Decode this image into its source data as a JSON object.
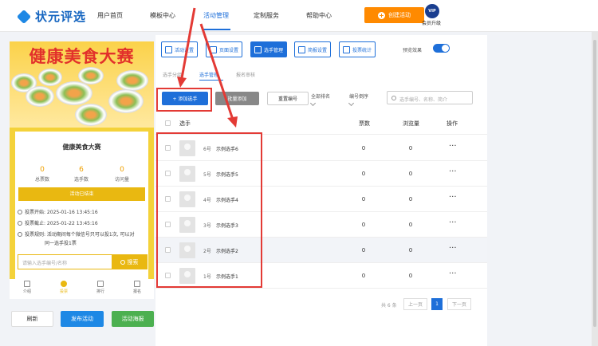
{
  "brand": {
    "name": "状元评选"
  },
  "nav": {
    "items": [
      "用户首页",
      "模板中心",
      "活动管理",
      "定制服务",
      "帮助中心"
    ],
    "create_label": "创建活动",
    "vip_text": "VIP",
    "vip_label": "会员升级"
  },
  "preview": {
    "banner_title": "健康美食大赛",
    "event_title": "健康美食大赛",
    "stats": [
      {
        "value": "0",
        "label": "总票数"
      },
      {
        "value": "6",
        "label": "选手数"
      },
      {
        "value": "0",
        "label": "访问量"
      }
    ],
    "status": "活动已结束",
    "vote_start": "投票开始: 2025-01-16 13:45:16",
    "vote_end": "投票截止: 2025-01-22 13:45:16",
    "rule_line1": "投票规则: 活动期间每个微信号只可以投1次, 可以对",
    "rule_line2": "同一选手投1票",
    "search_placeholder": "请输入选手编号/名称",
    "search_button": "搜索",
    "tabs": [
      "介绍",
      "投票",
      "排行",
      "报名"
    ]
  },
  "actions": {
    "refresh": "刷新",
    "publish": "发布活动",
    "poster": "活动海报"
  },
  "toolbar": {
    "buttons": [
      "活动设置",
      "页面设置",
      "选手管理",
      "简报设置",
      "投票统计"
    ],
    "preview_label": "预览效果"
  },
  "subtabs": [
    "选手分组",
    "选手管理",
    "报名审核"
  ],
  "controls": {
    "add": "+ 添加选手",
    "batch": "批量添加",
    "reset": "重置编号",
    "sort1": "全部排名",
    "sort2": "编号倒序",
    "search_placeholder": "选手编号、名称、简介"
  },
  "table": {
    "headers": [
      "选手",
      "票数",
      "浏览量",
      "操作"
    ],
    "rows": [
      {
        "num": "6号",
        "name": "示例选手6",
        "votes": "0",
        "views": "0"
      },
      {
        "num": "5号",
        "name": "示例选手5",
        "votes": "0",
        "views": "0"
      },
      {
        "num": "4号",
        "name": "示例选手4",
        "votes": "0",
        "views": "0"
      },
      {
        "num": "3号",
        "name": "示例选手3",
        "votes": "0",
        "views": "0"
      },
      {
        "num": "2号",
        "name": "示例选手2",
        "votes": "0",
        "views": "0"
      },
      {
        "num": "1号",
        "name": "示例选手1",
        "votes": "0",
        "views": "0"
      }
    ],
    "ops": "···"
  },
  "pagination": {
    "total": "共 6 条",
    "prev": "上一页",
    "current": "1",
    "next": "下一页"
  },
  "colors": {
    "primary": "#1e6fd9",
    "orange": "#ff8a00",
    "gold": "#e9b811",
    "annotation_red": "#e33a35",
    "green": "#4cb050"
  }
}
